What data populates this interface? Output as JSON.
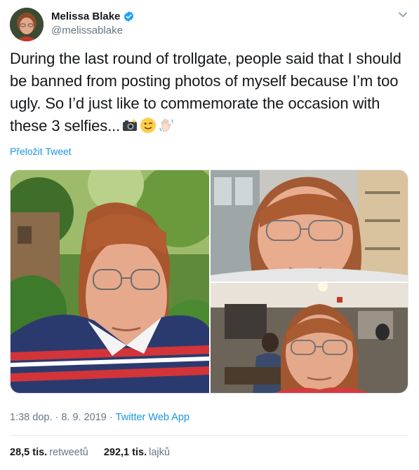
{
  "author": {
    "display_name": "Melissa Blake",
    "handle": "@melissablake",
    "verified": true
  },
  "tweet": {
    "text": "During the last round of trollgate, people said that I should be banned from posting photos of myself because I’m too ugly. So I’d just like to commemorate the occasion with these 3 selfies...",
    "emojis": [
      "camera-with-flash-icon",
      "winking-face-icon",
      "waving-hand-icon"
    ],
    "translate_label": "Přeložit Tweet"
  },
  "media": {
    "photo_count": 3
  },
  "meta": {
    "time": "1:38 dop.",
    "separator1": "·",
    "date": "8. 9. 2019",
    "separator2": "·",
    "source": "Twitter Web App"
  },
  "stats": {
    "retweets_value": "28,5 tis.",
    "retweets_label": "retweetů",
    "likes_value": "292,1 tis.",
    "likes_label": "lajků"
  },
  "colors": {
    "link_blue": "#1b95e0",
    "verified_blue": "#1da1f2",
    "secondary_text": "#657786",
    "primary_text": "#14171a"
  }
}
